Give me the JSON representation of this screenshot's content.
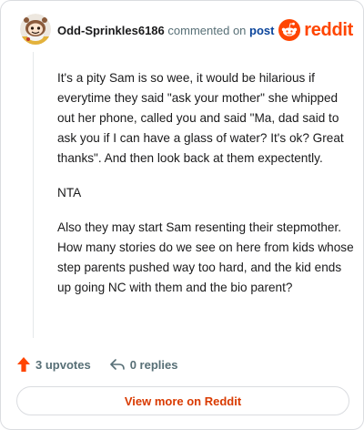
{
  "header": {
    "username": "Odd-Sprinkles6186",
    "verb": "commented on",
    "link_text": "post",
    "brand_word": "reddit",
    "brand_color": "#ff4500",
    "avatar_icon": "snoo-avatar-icon"
  },
  "comment": {
    "paragraphs": [
      "It's a pity Sam is so wee, it would be hilarious if everytime they said \"ask your mother\" she whipped out her phone, called you and said \"Ma, dad said to ask you if I can have a glass of water? It's ok? Great thanks\". And then look back at them expectently.",
      "NTA",
      "Also they may start Sam resenting their stepmother. How many stories do we see on here from kids whose step parents pushed way too hard, and the kid ends up going NC with them and the bio parent?"
    ]
  },
  "footer": {
    "upvotes": "3 upvotes",
    "replies": "0 replies",
    "upvote_color": "#ff4500"
  },
  "cta": {
    "label": "View more on Reddit",
    "color": "#d93a00"
  }
}
